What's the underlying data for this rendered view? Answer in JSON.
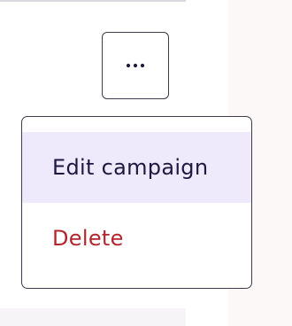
{
  "more_button": {
    "icon": "more-horizontal-icon",
    "color": "#1e1940"
  },
  "menu": {
    "items": [
      {
        "label": "Edit campaign",
        "state": "highlighted",
        "color": "#1e1940",
        "background": "#eee9fb"
      },
      {
        "label": "Delete",
        "state": "normal",
        "color": "#b3262d"
      }
    ]
  }
}
